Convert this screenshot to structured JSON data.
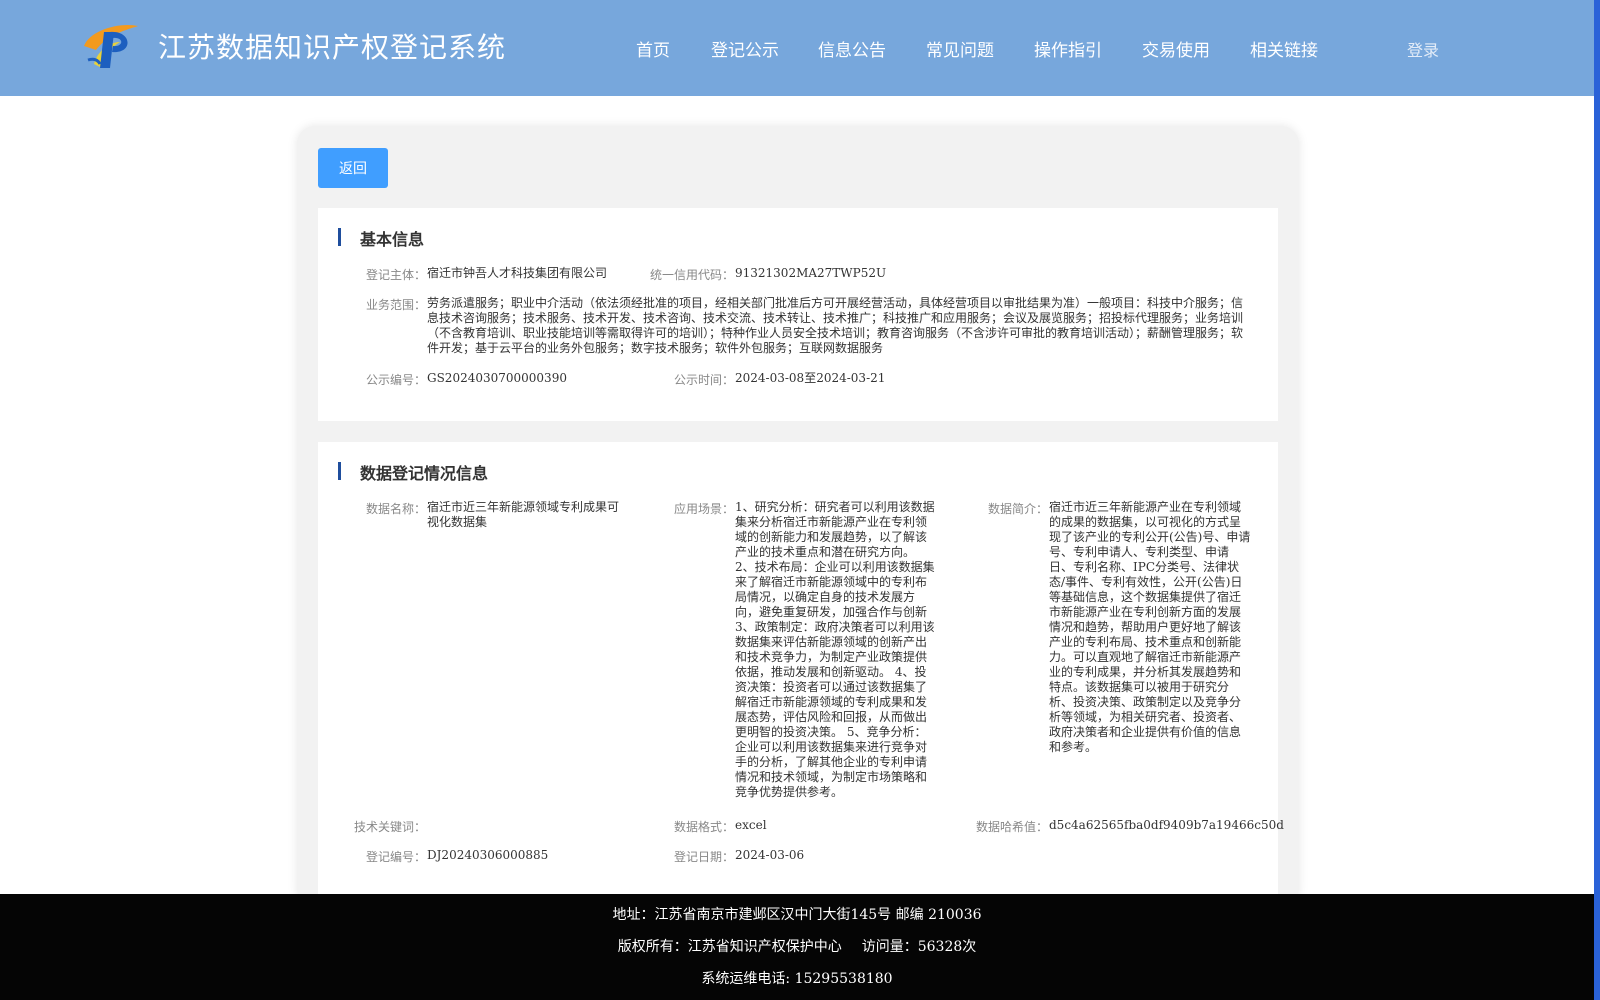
{
  "header": {
    "title": "江苏数据知识产权登记系统",
    "logo_icon": "p-logo-icon",
    "nav": [
      {
        "label": "首页"
      },
      {
        "label": "登记公示"
      },
      {
        "label": "信息公告"
      },
      {
        "label": "常见问题"
      },
      {
        "label": "操作指引"
      },
      {
        "label": "交易使用"
      },
      {
        "label": "相关链接"
      }
    ],
    "login_label": "登录"
  },
  "colors": {
    "header_bg": "#77a7dc",
    "primary_button": "#409eff",
    "section_bar": "#1f4e9d",
    "footer_bg": "#050505"
  },
  "back_label": "返回",
  "basic_info": {
    "title": "基本信息",
    "registrant_label": "登记主体：",
    "registrant": "宿迁市钟吾人才科技集团有限公司",
    "credit_code_label": "统一信用代码：",
    "credit_code": "91321302MA27TWP52U",
    "scope_label": "业务范围：",
    "scope": "劳务派遣服务；职业中介活动（依法须经批准的项目，经相关部门批准后方可开展经营活动，具体经营项目以审批结果为准）一般项目：科技中介服务；信息技术咨询服务；技术服务、技术开发、技术咨询、技术交流、技术转让、技术推广；科技推广和应用服务；会议及展览服务；招投标代理服务；业务培训（不含教育培训、职业技能培训等需取得许可的培训）；特种作业人员安全技术培训；教育咨询服务（不含涉许可审批的教育培训活动）；薪酬管理服务；软件开发；基于云平台的业务外包服务；数字技术服务；软件外包服务；互联网数据服务",
    "notice_no_label": "公示编号：",
    "notice_no": "GS2024030700000390",
    "notice_time_label": "公示时间：",
    "notice_start": "2024-03-08",
    "notice_to": "至",
    "notice_end": "2024-03-21"
  },
  "registration_info": {
    "title": "数据登记情况信息",
    "data_name_label": "数据名称：",
    "data_name": "宿迁市近三年新能源领域专利成果可视化数据集",
    "scenario_label": "应用场景：",
    "scenario": "1、研究分析：研究者可以利用该数据集来分析宿迁市新能源产业在专利领域的创新能力和发展趋势，以了解该产业的技术重点和潜在研究方向。 2、技术布局：企业可以利用该数据集来了解宿迁市新能源领域中的专利布局情况，以确定自身的技术发展方向，避免重复研发，加强合作与创新 3、政策制定：政府决策者可以利用该数据集来评估新能源领域的创新产出和技术竞争力，为制定产业政策提供依据，推动发展和创新驱动。 4、投资决策：投资者可以通过该数据集了解宿迁市新能源领域的专利成果和发展态势，评估风险和回报，从而做出更明智的投资决策。 5、竞争分析：企业可以利用该数据集来进行竞争对手的分析，了解其他企业的专利申请情况和技术领域，为制定市场策略和竞争优势提供参考。",
    "summary_label": "数据简介：",
    "summary": "宿迁市近三年新能源产业在专利领域的成果的数据集，以可视化的方式呈现了该产业的专利公开(公告)号、申请号、专利申请人、专利类型、申请日、专利名称、IPC分类号、法律状态/事件、专利有效性，公开(公告)日等基础信息，这个数据集提供了宿迁市新能源产业在专利创新方面的发展情况和趋势，帮助用户更好地了解该产业的专利布局、技术重点和创新能力。可以直观地了解宿迁市新能源产业的专利成果，并分析其发展趋势和特点。该数据集可以被用于研究分析、投资决策、政策制定以及竞争分析等领域，为相关研究者、投资者、政府决策者和企业提供有价值的信息和参考。",
    "keywords_label": "技术关键词：",
    "keywords": "",
    "format_label": "数据格式：",
    "format": "excel",
    "hash_label": "数据哈希值：",
    "hash": "d5c4a62565fba0df9409b7a19466c50d",
    "reg_no_label": "登记编号：",
    "reg_no": "DJ20240306000885",
    "reg_date_label": "登记日期：",
    "reg_date": "2024-03-06"
  },
  "footer": {
    "address": "地址：江苏省南京市建邺区汉中门大街145号 邮编 210036",
    "copyright": "版权所有：江苏省知识产权保护中心",
    "visits": "访问量：56328次",
    "phone": "系统运维电话: 15295538180"
  }
}
